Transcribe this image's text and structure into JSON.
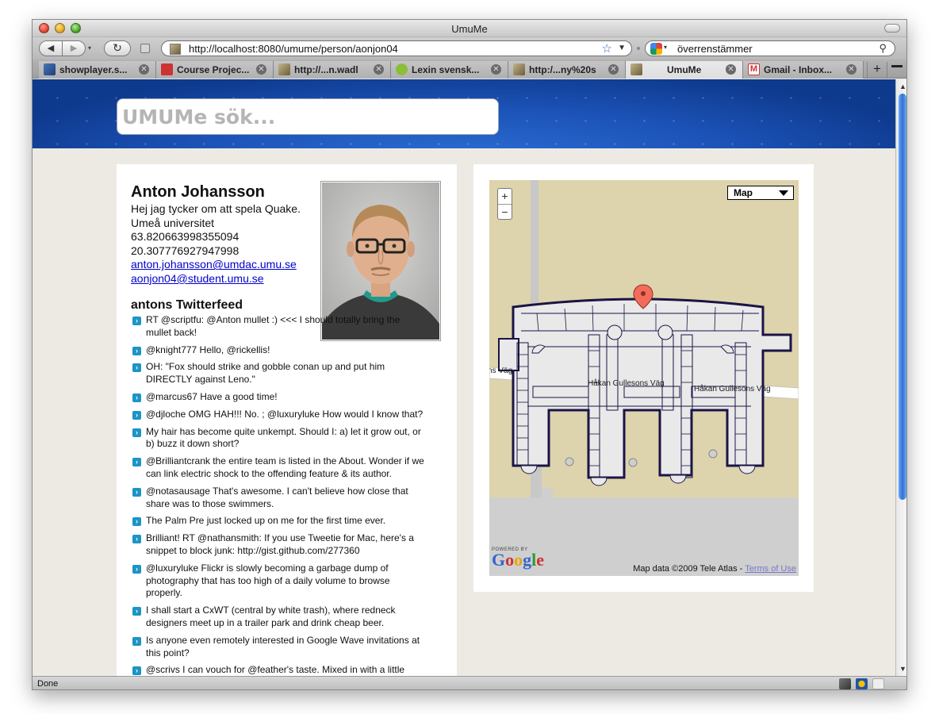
{
  "window": {
    "title": "UmuMe"
  },
  "toolbar": {
    "url": "http://localhost:8080/umume/person/aonjon04",
    "search_query": "överrenstämmer"
  },
  "tabs": [
    {
      "label": "showplayer.s...",
      "active": false
    },
    {
      "label": "Course Projec...",
      "active": false
    },
    {
      "label": "http://...n.wadl",
      "active": false
    },
    {
      "label": "Lexin svensk...",
      "active": false
    },
    {
      "label": "http:/...ny%20s",
      "active": false
    },
    {
      "label": "UmuMe",
      "active": true
    },
    {
      "label": "Gmail - Inbox...",
      "active": false
    }
  ],
  "header": {
    "search_placeholder": "UMUMe sök..."
  },
  "person": {
    "name": "Anton Johansson",
    "bio": "Hej jag tycker om att spela Quake.",
    "organization": "Umeå universitet",
    "latitude": "63.820663998355094",
    "longitude": "20.307776927947998",
    "email_primary": "anton.johansson@umdac.umu.se",
    "email_student": "aonjon04@student.umu.se"
  },
  "twitter": {
    "title": "antons Twitterfeed",
    "tweets": [
      "RT @scriptfu: @Anton mullet :) <<< I should totally bring the mullet back!",
      "@knight777 Hello, @rickellis!",
      "OH: \"Fox should strike and gobble conan up and put him DIRECTLY against Leno.\"",
      "@marcus67 Have a good time!",
      "@djloche OMG HAH!!! No. ; @luxuryluke How would I know that?",
      "My hair has become quite unkempt. Should I: a) let it grow out, or b) buzz it down short?",
      "@Brilliantcrank the entire team is listed in the About. Wonder if we can link electric shock to the offending feature & its author.",
      "@notasausage That's awesome. I can't believe how close that share was to those swimmers.",
      "The Palm Pre just locked up on me for the first time ever.",
      "Brilliant! RT @nathansmith: If you use Tweetie for Mac, here's a snippet to block junk: http://gist.github.com/277360",
      "@luxuryluke Flickr is slowly becoming a garbage dump of photography that has too high of a daily volume to browse properly.",
      "I shall start a CxWT (central by white trash), where redneck designers meet up in a trailer park and drink cheap beer.",
      "Is anyone even remotely interested in Google Wave invitations at this point?",
      "@scrivs I can vouch for @feather's taste. Mixed in with a little classical scottish bagpipe folk as well."
    ]
  },
  "map": {
    "map_type": "Map",
    "zoom_in": "+",
    "zoom_out": "−",
    "road_left": "ns Väg",
    "road_1": "Håkan Gullesons Väg",
    "road_2": "Håkan Gullesons Väg",
    "powered_by": "POWERED BY",
    "attribution": "Map data ©2009 Tele Atlas - ",
    "terms": "Terms of Use"
  },
  "status": {
    "text": "Done"
  }
}
